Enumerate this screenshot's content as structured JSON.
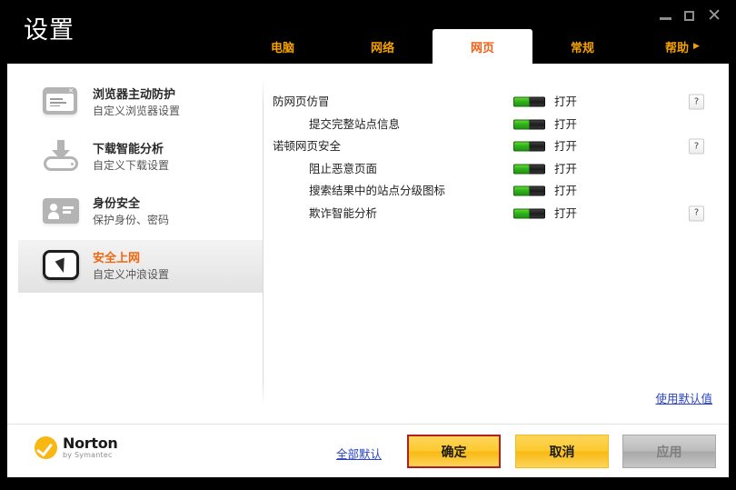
{
  "window": {
    "title": "设置",
    "controls": {
      "minimize": "minimize",
      "maximize": "maximize",
      "close": "✕"
    }
  },
  "tabs": [
    {
      "label": "电脑",
      "active": false
    },
    {
      "label": "网络",
      "active": false
    },
    {
      "label": "网页",
      "active": true
    },
    {
      "label": "常规",
      "active": false
    },
    {
      "label": "帮助",
      "active": false,
      "caret": "▶"
    }
  ],
  "sidebar": {
    "items": [
      {
        "title": "浏览器主动防护",
        "subtitle": "自定义浏览器设置",
        "icon": "browser-window-icon",
        "active": false
      },
      {
        "title": "下载智能分析",
        "subtitle": "自定义下载设置",
        "icon": "download-drive-icon",
        "active": false
      },
      {
        "title": "身份安全",
        "subtitle": "保护身份、密码",
        "icon": "id-card-icon",
        "active": false
      },
      {
        "title": "安全上网",
        "subtitle": "自定义冲浪设置",
        "icon": "cursor-screen-icon",
        "active": true
      }
    ]
  },
  "settings": {
    "rows": [
      {
        "label": "防网页仿冒",
        "indent": false,
        "state": "打开",
        "toggle": "on",
        "help": true
      },
      {
        "label": "提交完整站点信息",
        "indent": true,
        "state": "打开",
        "toggle": "on",
        "help": false
      },
      {
        "label": "诺顿网页安全",
        "indent": false,
        "state": "打开",
        "toggle": "on",
        "help": true
      },
      {
        "label": "阻止恶意页面",
        "indent": true,
        "state": "打开",
        "toggle": "on",
        "help": false
      },
      {
        "label": "搜索结果中的站点分级图标",
        "indent": true,
        "state": "打开",
        "toggle": "on",
        "help": false
      },
      {
        "label": "欺诈智能分析",
        "indent": true,
        "state": "打开",
        "toggle": "on",
        "help": true
      }
    ],
    "use_default_link": "使用默认值",
    "help_glyph": "?"
  },
  "footer": {
    "logo_name": "Norton",
    "logo_sub": "by Symantec",
    "all_default_link": "全部默认",
    "ok_label": "确定",
    "cancel_label": "取消",
    "apply_label": "应用"
  },
  "colors": {
    "accent_orange": "#f5a200",
    "active_tab_text": "#f25f12",
    "link_blue": "#2b44c6",
    "toggle_green": "#2fb11a",
    "norton_yellow": "#f8b712",
    "focus_red": "#b02020"
  }
}
